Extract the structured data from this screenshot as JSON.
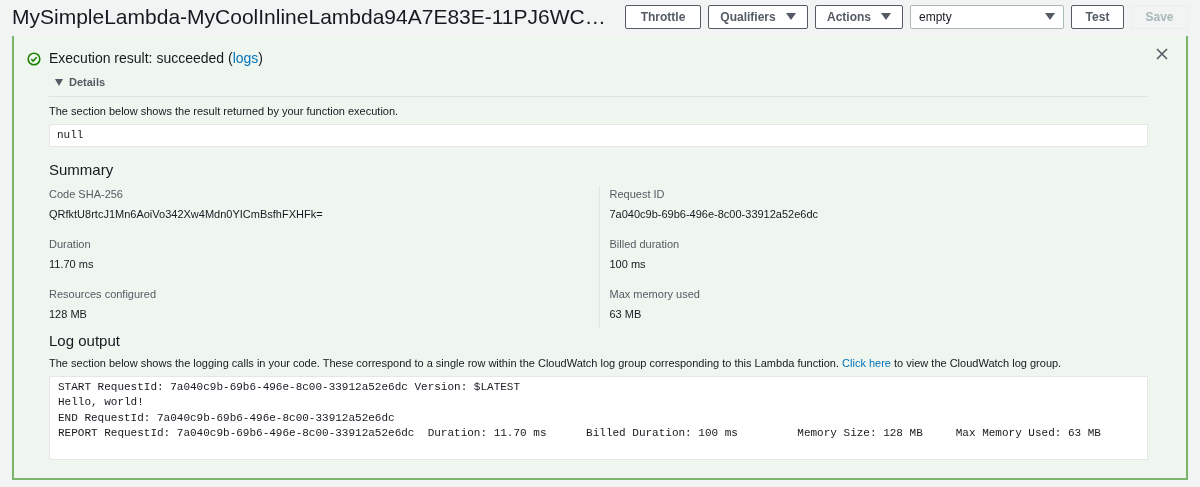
{
  "header": {
    "title": "MySimpleLambda-MyCoolInlineLambda94A7E83E-11PJ6WC…",
    "controls": [
      {
        "kind": "button",
        "label": "Throttle",
        "disabled": false
      },
      {
        "kind": "dropdown",
        "label": "Qualifiers",
        "disabled": false
      },
      {
        "kind": "dropdown",
        "label": "Actions",
        "disabled": false
      },
      {
        "kind": "select",
        "label": "empty",
        "disabled": false
      },
      {
        "kind": "button",
        "label": "Test",
        "disabled": false
      },
      {
        "kind": "button",
        "label": "Save",
        "disabled": true
      }
    ]
  },
  "result": {
    "kind": "success",
    "message_before": "Execution result: succeeded (",
    "link": "logs",
    "message_after": ")",
    "details": {
      "label": "Details",
      "expanded": true,
      "description": "The section below shows the result returned by your function execution.",
      "output": "null",
      "summary_title": "Summary",
      "summary": [
        {
          "label": "Code SHA-256",
          "value": "QRfktU8rtcJ1Mn6AoiVo342Xw4Mdn0YICmBsfhFXHFk="
        },
        {
          "label": "Request ID",
          "value": "7a040c9b-69b6-496e-8c00-33912a52e6dc"
        },
        {
          "label": "Duration",
          "value": "11.70 ms"
        },
        {
          "label": "Billed duration",
          "value": "100 ms"
        },
        {
          "label": "Resources configured",
          "value": "128 MB"
        },
        {
          "label": "Max memory used",
          "value": "63 MB"
        }
      ],
      "log_title": "Log output",
      "log_description_before": "The section below shows the logging calls in your code. These correspond to a single row within the CloudWatch log group corresponding to this Lambda function.",
      "log_link": "Click here",
      "log_description_after": "to view the CloudWatch log group.",
      "log_lines": [
        "START RequestId: 7a040c9b-69b6-496e-8c00-33912a52e6dc Version: $LATEST",
        "Hello, world!",
        "END RequestId: 7a040c9b-69b6-496e-8c00-33912a52e6dc",
        "REPORT RequestId: 7a040c9b-69b6-496e-8c00-33912a52e6dc  Duration: 11.70 ms      Billed Duration: 100 ms         Memory Size: 128 MB     Max Memory Used: 63 MB"
      ]
    }
  }
}
